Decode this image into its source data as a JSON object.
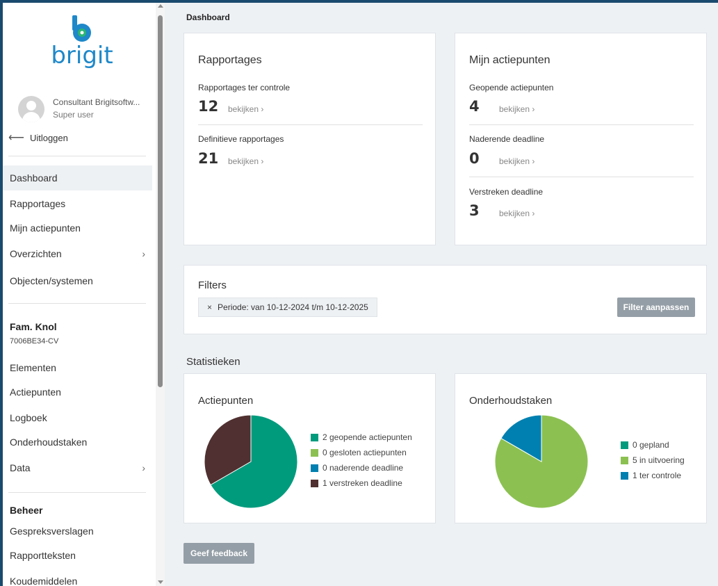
{
  "app": {
    "logo_text": "brigit",
    "colors": {
      "brand": "#1e88c9",
      "brand_green": "#2bb673",
      "teal": "#009b7d",
      "light_green": "#8cc152",
      "blue": "#0080b0",
      "brown": "#503030"
    }
  },
  "user": {
    "name": "Consultant Brigitsoftw...",
    "role": "Super user",
    "logout_label": "Uitloggen"
  },
  "sidebar": {
    "main_nav": [
      {
        "label": "Dashboard",
        "active": true
      },
      {
        "label": "Rapportages"
      },
      {
        "label": "Mijn actiepunten"
      },
      {
        "label": "Overzichten",
        "chevron": "›"
      },
      {
        "label": "Objecten/systemen"
      }
    ],
    "object": {
      "title": "Fam. Knol",
      "code": "7006BE34-CV",
      "items": [
        {
          "label": "Elementen"
        },
        {
          "label": "Actiepunten"
        },
        {
          "label": "Logboek"
        },
        {
          "label": "Onderhoudstaken"
        },
        {
          "label": "Data",
          "chevron": "›"
        }
      ]
    },
    "beheer": {
      "title": "Beheer",
      "items": [
        {
          "label": "Gespreksverslagen"
        },
        {
          "label": "Rapportteksten"
        },
        {
          "label": "Koudemiddelen"
        }
      ]
    }
  },
  "breadcrumb": "Dashboard",
  "rapportages_card": {
    "title": "Rapportages",
    "metrics": [
      {
        "label": "Rapportages ter controle",
        "value": "12",
        "link": "bekijken ›"
      },
      {
        "label": "Definitieve rapportages",
        "value": "21",
        "link": "bekijken ›"
      }
    ]
  },
  "actiepunten_card": {
    "title": "Mijn actiepunten",
    "metrics": [
      {
        "label": "Geopende actiepunten",
        "value": "4",
        "link": "bekijken ›"
      },
      {
        "label": "Naderende deadline",
        "value": "0",
        "link": "bekijken ›"
      },
      {
        "label": "Verstreken deadline",
        "value": "3",
        "link": "bekijken ›"
      }
    ]
  },
  "filters": {
    "title": "Filters",
    "chip_close": "×",
    "chip_label": "Periode: van 10-12-2024 t/m 10-12-2025",
    "button_label": "Filter aanpassen"
  },
  "statistics": {
    "heading": "Statistieken"
  },
  "feedback_button": "Geef feedback",
  "chart_data": [
    {
      "type": "pie",
      "title": "Actiepunten",
      "slices": [
        {
          "name": "2 geopende actiepunten",
          "value": 2,
          "color": "#009b7d"
        },
        {
          "name": "0 gesloten actiepunten",
          "value": 0,
          "color": "#8cc152"
        },
        {
          "name": "0 naderende deadline",
          "value": 0,
          "color": "#0080b0"
        },
        {
          "name": "1 verstreken deadline",
          "value": 1,
          "color": "#503030"
        }
      ],
      "legend_placement": "right"
    },
    {
      "type": "pie",
      "title": "Onderhoudstaken",
      "slices": [
        {
          "name": "0 gepland",
          "value": 0,
          "color": "#009b7d"
        },
        {
          "name": "5 in uitvoering",
          "value": 5,
          "color": "#8cc152"
        },
        {
          "name": "1 ter controle",
          "value": 1,
          "color": "#0080b0"
        }
      ],
      "legend_placement": "right"
    }
  ]
}
